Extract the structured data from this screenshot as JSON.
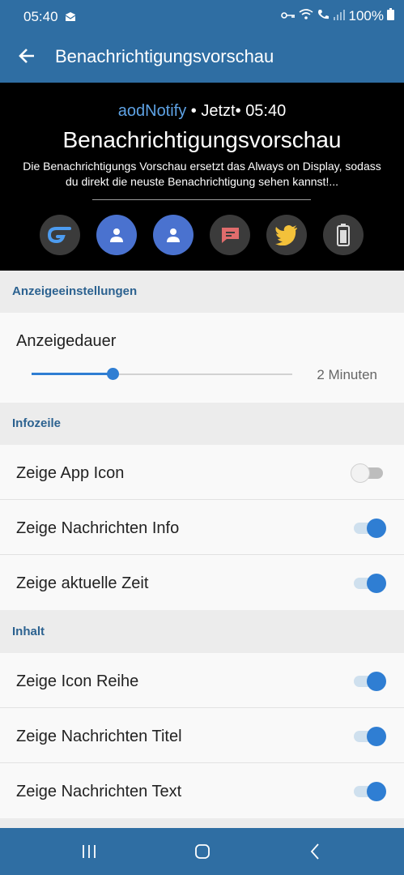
{
  "status_bar": {
    "time": "05:40",
    "battery": "100%",
    "icons": [
      "mail-icon",
      "key-icon",
      "wifi-icon",
      "call-icon",
      "signal-icon",
      "battery-icon"
    ]
  },
  "app_bar": {
    "title": "Benachrichtigungsvorschau",
    "back_icon": "back-arrow-icon"
  },
  "preview": {
    "app_name": "aodNotify",
    "sep1": " • ",
    "when": "Jetzt",
    "sep2": "• ",
    "time": "05:40",
    "title": "Benachrichtigungsvorschau",
    "text": "Die Benachrichtigungs Vorschau ersetzt das Always on Display, sodass du direkt die neuste Benachrichtigung sehen kannst!...",
    "icons": [
      "aodnotify-icon",
      "contact-icon",
      "contact-icon",
      "message-icon",
      "twitter-icon",
      "battery-icon"
    ]
  },
  "sections": {
    "display": {
      "header": "Anzeigeeinstellungen",
      "slider_label": "Anzeigedauer",
      "slider_value": "2 Minuten",
      "slider_fraction": 0.31
    },
    "infoline": {
      "header": "Infozeile",
      "rows": [
        {
          "label": "Zeige App Icon",
          "on": false
        },
        {
          "label": "Zeige Nachrichten Info",
          "on": true
        },
        {
          "label": "Zeige aktuelle Zeit",
          "on": true
        }
      ]
    },
    "content": {
      "header": "Inhalt",
      "rows": [
        {
          "label": "Zeige Icon Reihe",
          "on": true
        },
        {
          "label": "Zeige Nachrichten Titel",
          "on": true
        },
        {
          "label": "Zeige Nachrichten Text",
          "on": true
        }
      ]
    }
  },
  "colors": {
    "primary": "#2f6ea3",
    "accent": "#2f7ed3",
    "section_text": "#2c6290"
  },
  "nav_bar": {
    "icons": [
      "recents-icon",
      "home-icon",
      "back-icon"
    ]
  }
}
